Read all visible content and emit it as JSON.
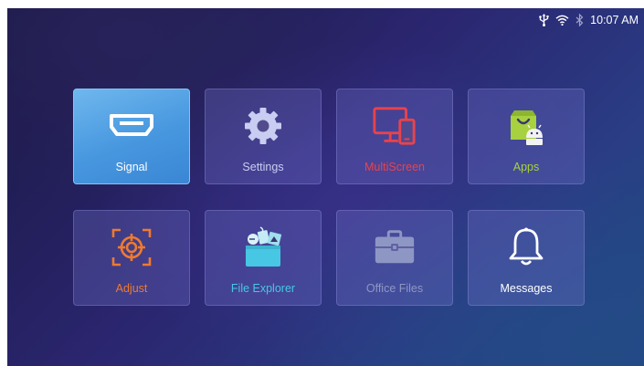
{
  "status_bar": {
    "time": "10:07 AM",
    "icons": [
      "usb-icon",
      "wifi-icon",
      "bluetooth-icon"
    ]
  },
  "tiles": [
    {
      "label": "Signal",
      "icon": "hdmi-icon",
      "color": "#ffffff",
      "selected": true
    },
    {
      "label": "Settings",
      "icon": "gear-icon",
      "color": "#c9cdf2"
    },
    {
      "label": "MultiScreen",
      "icon": "multiscreen-icon",
      "color": "#e8434c"
    },
    {
      "label": "Apps",
      "icon": "android-store-icon",
      "color": "#a7d13f"
    },
    {
      "label": "Adjust",
      "icon": "crosshair-icon",
      "color": "#ef7a2e"
    },
    {
      "label": "File Explorer",
      "icon": "media-folder-icon",
      "color": "#47c7e3"
    },
    {
      "label": "Office Files",
      "icon": "briefcase-icon",
      "color": "#8e97c4"
    },
    {
      "label": "Messages",
      "icon": "bell-icon",
      "color": "#ffffff"
    }
  ]
}
